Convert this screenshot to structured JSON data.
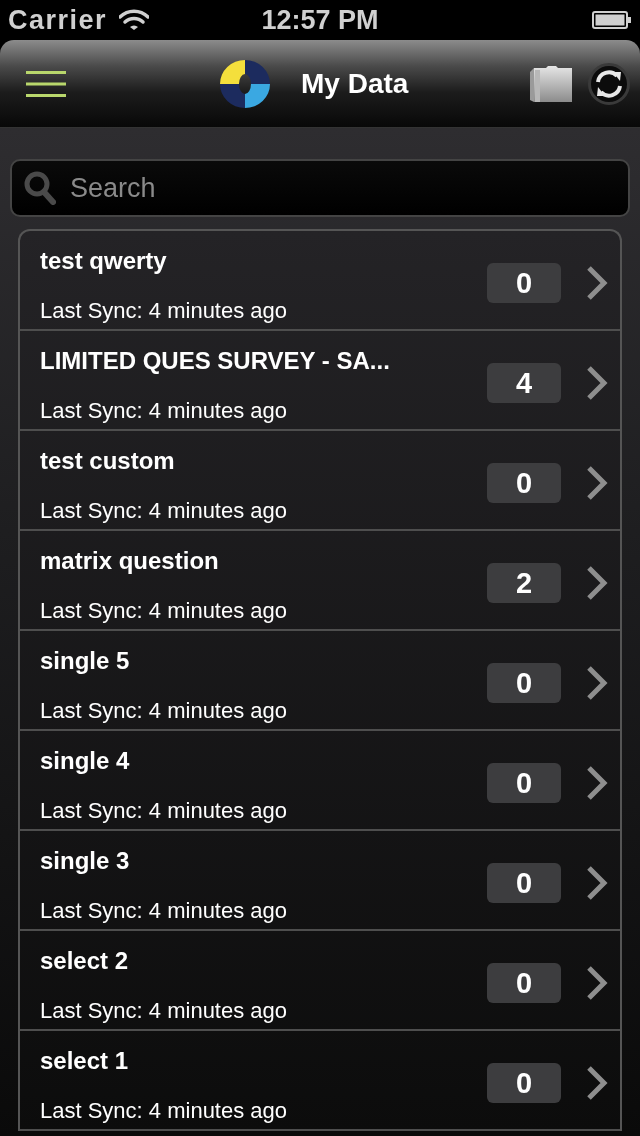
{
  "status_bar": {
    "carrier": "Carrier",
    "time": "12:57 PM"
  },
  "nav_bar": {
    "title": "My Data"
  },
  "search": {
    "placeholder": "Search"
  },
  "items": [
    {
      "title": "test qwerty",
      "subtitle": "Last Sync: 4 minutes ago",
      "count": "0"
    },
    {
      "title": "LIMITED QUES SURVEY - SA...",
      "subtitle": "Last Sync: 4 minutes ago",
      "count": "4"
    },
    {
      "title": "test custom",
      "subtitle": "Last Sync: 4 minutes ago",
      "count": "0"
    },
    {
      "title": "matrix question",
      "subtitle": "Last Sync: 4 minutes ago",
      "count": "2"
    },
    {
      "title": "single 5",
      "subtitle": "Last Sync: 4 minutes ago",
      "count": "0"
    },
    {
      "title": "single 4",
      "subtitle": "Last Sync: 4 minutes ago",
      "count": "0"
    },
    {
      "title": "single 3",
      "subtitle": "Last Sync: 4 minutes ago",
      "count": "0"
    },
    {
      "title": "select 2",
      "subtitle": "Last Sync: 4 minutes ago",
      "count": "0"
    },
    {
      "title": "select 1",
      "subtitle": "Last Sync: 4 minutes ago",
      "count": "0"
    }
  ]
}
